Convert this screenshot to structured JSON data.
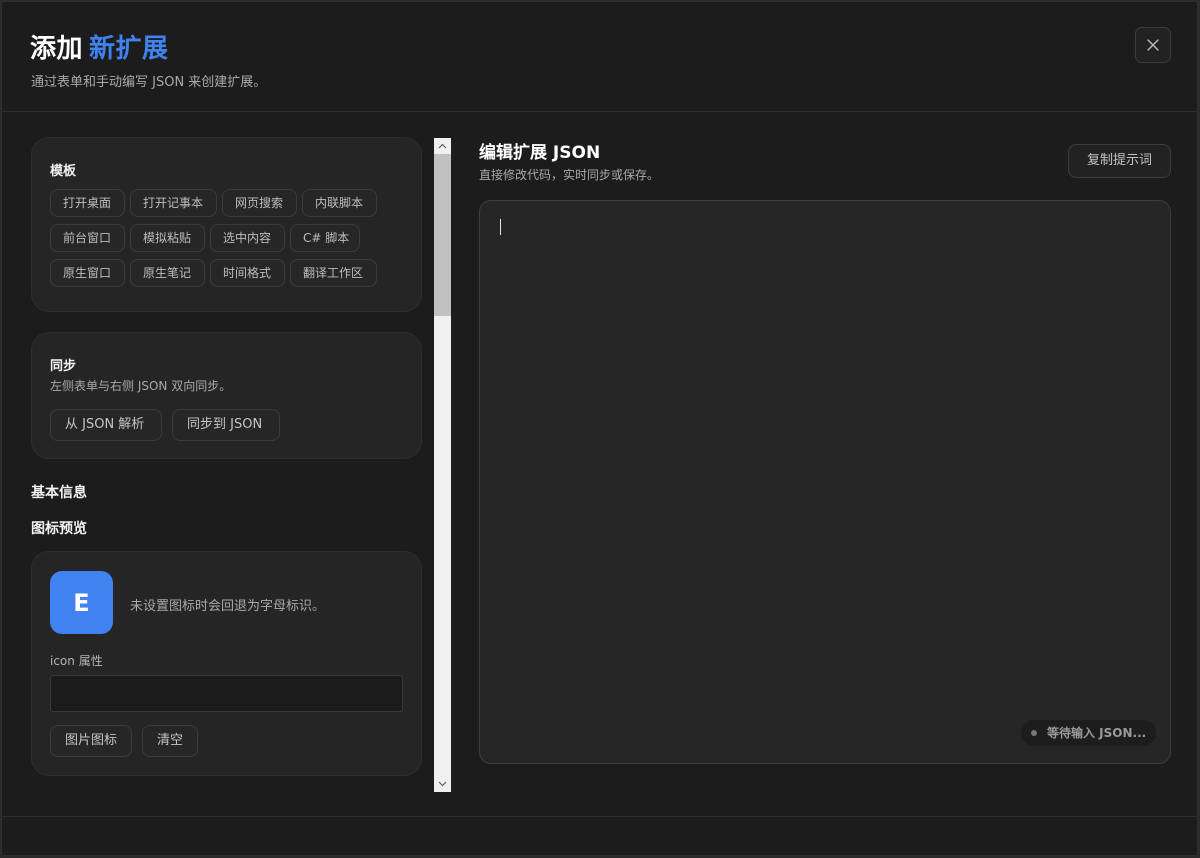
{
  "header": {
    "title_prefix": "添加",
    "title_accent": "新扩展",
    "subtitle": "通过表单和手动编写 JSON 来创建扩展。"
  },
  "templates": {
    "title": "模板",
    "items": [
      "打开桌面",
      "打开记事本",
      "网页搜索",
      "内联脚本",
      "前台窗口",
      "模拟粘贴",
      "选中内容",
      "C# 脚本",
      "原生窗口",
      "原生笔记",
      "时间格式",
      "翻译工作区"
    ]
  },
  "sync": {
    "title": "同步",
    "description": "左侧表单与右侧 JSON 双向同步。",
    "parse_button": "从 JSON 解析",
    "sync_button": "同步到 JSON"
  },
  "basic_info": {
    "heading": "基本信息"
  },
  "icon_preview": {
    "heading": "图标预览",
    "letter": "E",
    "hint": "未设置图标时会回退为字母标识。",
    "field_label": "icon 属性",
    "field_value": "",
    "image_button": "图片图标",
    "clear_button": "清空"
  },
  "editor": {
    "title": "编辑扩展 JSON",
    "description": "直接修改代码，实时同步或保存。",
    "copy_button": "复制提示词",
    "status": "等待输入 JSON..."
  },
  "colors": {
    "accent": "#3f82f0",
    "background": "#1c1c1c",
    "card": "#252525"
  }
}
